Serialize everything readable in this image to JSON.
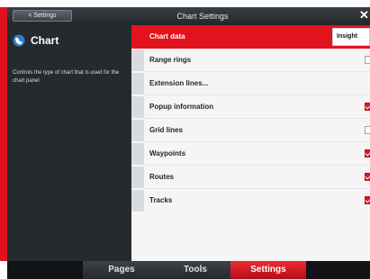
{
  "header": {
    "back_label": "< Settings",
    "title": "Chart Settings",
    "close_symbol": "✕"
  },
  "info_panel": {
    "icon": "chart-icon",
    "title": "Chart",
    "description": "Controls the type of chart that is used for the chart panel"
  },
  "settings": {
    "chart_data": {
      "label": "Chart data",
      "value": "Insight"
    },
    "items": [
      {
        "label": "Range rings",
        "checked": false
      },
      {
        "label": "Extension lines...",
        "checked": null
      },
      {
        "label": "Popup information",
        "checked": true
      },
      {
        "label": "Grid lines",
        "checked": false
      },
      {
        "label": "Waypoints",
        "checked": true
      },
      {
        "label": "Routes",
        "checked": true
      },
      {
        "label": "Tracks",
        "checked": true
      }
    ]
  },
  "tabs": [
    {
      "label": "Pages",
      "active": false
    },
    {
      "label": "Tools",
      "active": false
    },
    {
      "label": "Settings",
      "active": true
    }
  ],
  "colors": {
    "accent": "#e3131d",
    "panel_dark": "#252a2f",
    "list_bg": "#f5f5f5"
  }
}
